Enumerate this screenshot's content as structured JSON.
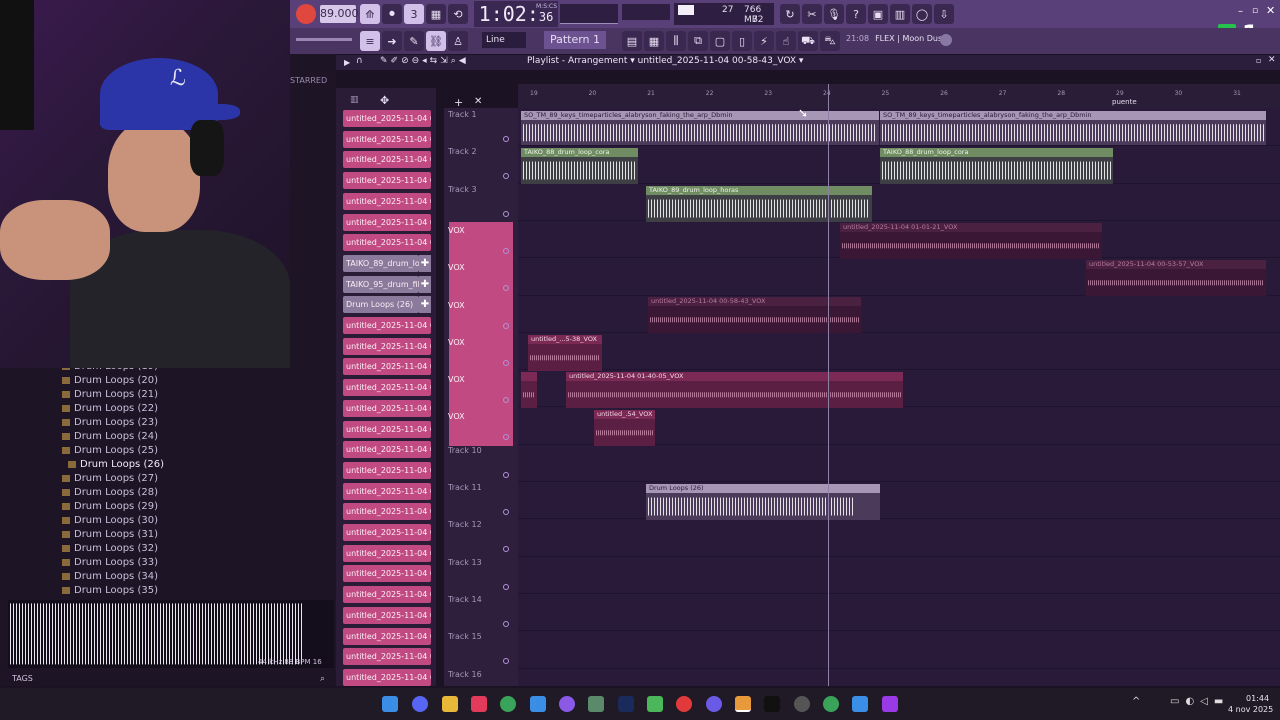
{
  "toolbar": {
    "tempo": "89.000",
    "time": "1:02",
    "time_sub": "36",
    "msc": "M:S:CS",
    "cpu_value": "27",
    "mem_value": "766 MB",
    "poly_value": "72",
    "pattern": "Pattern 1",
    "snap": "Line",
    "hint_time": "21:08",
    "hint_text": "FLEX | Moon Dust",
    "logo_text": "1"
  },
  "playlist": {
    "title": "Playlist - Arrangement",
    "arrangement": "untitled_2025-11-04 00-58-43_VOX",
    "ticks": [
      "19",
      "20",
      "21",
      "22",
      "23",
      "24",
      "25",
      "26",
      "27",
      "28",
      "29",
      "30",
      "31"
    ],
    "marker": "puente"
  },
  "browser": {
    "starred": "STARRED",
    "items": [
      "Drum Loops (19)",
      "Drum Loops (20)",
      "Drum Loops (21)",
      "Drum Loops (22)",
      "Drum Loops (23)",
      "Drum Loops (24)",
      "Drum Loops (25)",
      "Drum Loops (26)",
      "Drum Loops (27)",
      "Drum Loops (28)",
      "Drum Loops (29)",
      "Drum Loops (30)",
      "Drum Loops (31)",
      "Drum Loops (32)",
      "Drum Loops (33)",
      "Drum Loops (34)",
      "Drum Loops (35)"
    ],
    "selected_index": 7,
    "preview_info": "44 kHz 88 BPM 16",
    "tags": "TAGS"
  },
  "channels": [
    "untitled_2025-11-04 00-",
    "untitled_2025-11-04 00-",
    "untitled_2025-11-04 00-",
    "untitled_2025-11-04 00-",
    "untitled_2025-11-04 00-",
    "untitled_2025-11-04 00-",
    "untitled_2025-11-04 01-",
    "TAIKO_89_drum_loo...",
    "TAIKO_95_drum_fill_...",
    "Drum Loops (26)",
    "untitled_2025-11-04 01-",
    "untitled_2025-11-04 01-",
    "untitled_2025-11-04 01-",
    "untitled_2025-11-04 01-",
    "untitled_2025-11-04 01-",
    "untitled_2025-11-04 01-",
    "untitled_2025-11-04 01-",
    "untitled_2025-11-04 01-",
    "untitled_2025-11-04 01-",
    "untitled_2025-11-04 01-",
    "untitled_2025-11-04 01-",
    "untitled_2025-11-04 01-",
    "untitled_2025-11-04 01-",
    "untitled_2025-11-04 01-",
    "untitled_2025-11-04 01-",
    "untitled_2025-11-04 01-",
    "untitled_2025-11-04 01-",
    "untitled_2025-11-04 01-",
    "untitled_2025-11-04 01-"
  ],
  "tracks": [
    "Track 1",
    "Track 2",
    "Track 3",
    "VOX",
    "VOX",
    "VOX",
    "VOX",
    "VOX",
    "VOX",
    "Track 10",
    "Track 11",
    "Track 12",
    "Track 13",
    "Track 14",
    "Track 15",
    "Track 16"
  ],
  "clips": [
    "SO_TM_89_keys_timeparticles_alabryson_faking_the_arp_Dbmin",
    "SO_TM_89_keys_timeparticles_alabryson_faking_the_arp_Dbmin",
    "TAIKO_88_drum_loop_cora",
    "TAIKO_88_drum_loop_cora",
    "TAIKO_89_drum_loop_horas",
    "untitled_2025-11-04 01-01-21_VOX",
    "untitled_2025-11-04 00-53-57_VOX",
    "untitled_2025-11-04 00-58-43_VOX",
    "untitled_...5-38_VOX",
    "untitled_2025-11-04 01-40-05_VOX",
    "untitled_.54_VOX",
    "Drum Loops (26)"
  ],
  "taskbar": {
    "time": "01:44",
    "date": "4 nov 2025"
  }
}
